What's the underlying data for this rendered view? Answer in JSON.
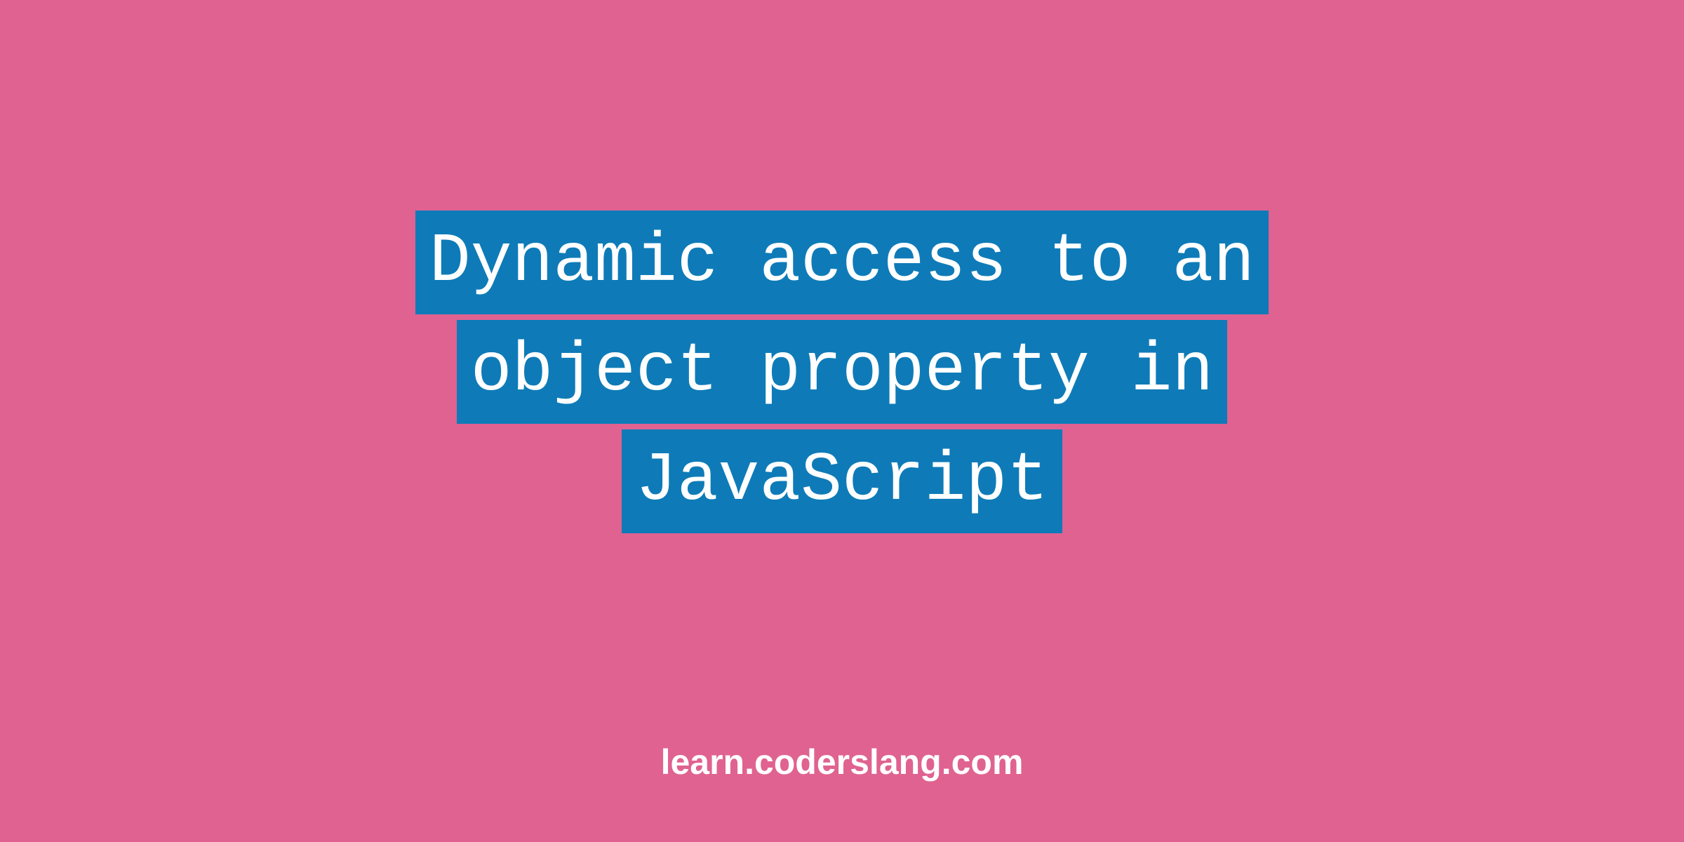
{
  "title": {
    "line1": "Dynamic access to an",
    "line2": "object property in",
    "line3": "JavaScript"
  },
  "footer": {
    "text": "learn.coderslang.com"
  },
  "colors": {
    "background": "#e06291",
    "highlight": "#0e7bb8",
    "text": "#ffffff"
  }
}
